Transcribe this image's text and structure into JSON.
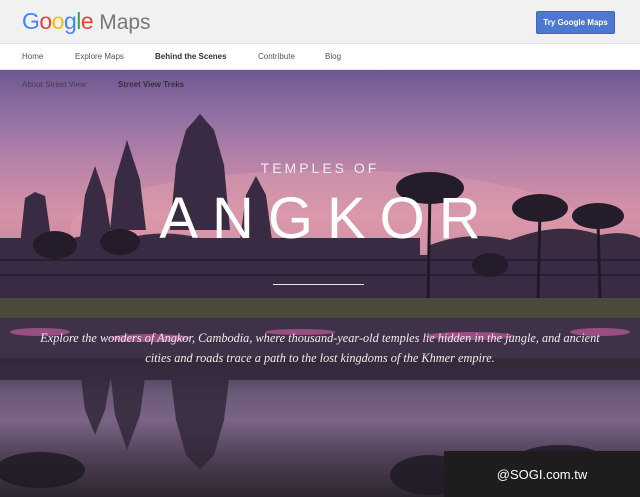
{
  "header": {
    "logo_google_letters": [
      "G",
      "o",
      "o",
      "g",
      "l",
      "e"
    ],
    "logo_maps": "Maps",
    "cta_label": "Try Google Maps"
  },
  "nav": {
    "items": [
      {
        "label": "Home",
        "active": false
      },
      {
        "label": "Explore Maps",
        "active": false
      },
      {
        "label": "Behind the Scenes",
        "active": true
      },
      {
        "label": "Contribute",
        "active": false
      },
      {
        "label": "Blog",
        "active": false
      }
    ]
  },
  "subnav": {
    "items": [
      {
        "label": "About Street View",
        "active": false
      },
      {
        "label": "Street View Treks",
        "active": true
      }
    ]
  },
  "hero": {
    "kicker": "TEMPLES OF",
    "title": "ANGKOR",
    "description": "Explore the wonders of Angkor, Cambodia, where thousand-year-old temples lie hidden in the jungle, and ancient cities and roads trace a path to the lost kingdoms of the Khmer empire."
  },
  "watermark": "@SOGI.com.tw",
  "colors": {
    "cta_bg": "#4d78d1",
    "header_bg": "#f1f1f1",
    "nav_bg": "#ffffff"
  }
}
